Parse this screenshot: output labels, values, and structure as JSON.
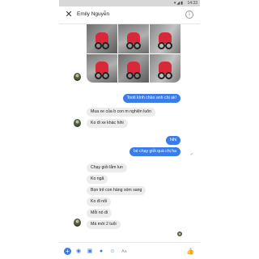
{
  "status": {
    "time": "14:33",
    "icons": "▾◢▮"
  },
  "header": {
    "contact_name": "Emily Nguyễn",
    "close_glyph": "✕",
    "info_glyph": "i"
  },
  "messages": [
    {
      "side": "out",
      "text": "Tooti kính chào anh chị ak!"
    },
    {
      "side": "in",
      "text": "Mua xe của b con m nghiện luôn"
    },
    {
      "side": "in",
      "text": "Ko đi xe khác hihi"
    },
    {
      "side": "out",
      "text": "hihi"
    },
    {
      "side": "out",
      "text": "bé chạy giỏi quá chị ha"
    },
    {
      "side": "in",
      "text": "Chạy giỏi lắm lun"
    },
    {
      "side": "in",
      "text": "Ko ngã"
    },
    {
      "side": "in",
      "text": "Bọn trẻ con hàng xóm sang"
    },
    {
      "side": "in",
      "text": "Ko đi nổi"
    },
    {
      "side": "in",
      "text": "Mỗi nó đi"
    },
    {
      "side": "in",
      "text": "Mà mới 2 tuổi"
    }
  ],
  "composer": {
    "placeholder": "Aa",
    "icons": [
      "plus-icon",
      "camera-icon",
      "gallery-icon",
      "microphone-icon",
      "like-icon"
    ]
  },
  "colors": {
    "accent": "#3a7ce8",
    "incoming_bubble": "#ececec"
  }
}
